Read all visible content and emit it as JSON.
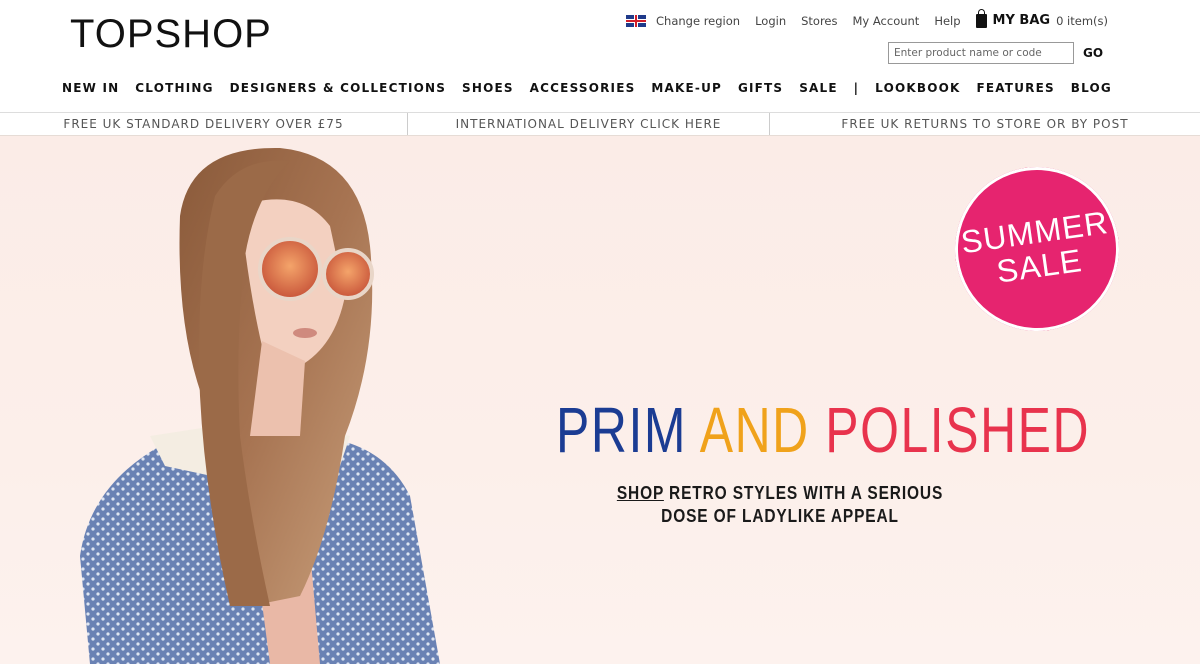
{
  "header": {
    "logo": "TOPSHOP",
    "utility": {
      "change_region": "Change region",
      "login": "Login",
      "stores": "Stores",
      "my_account": "My Account",
      "help": "Help",
      "bag_label": "MY BAG",
      "bag_count": "0 item(s)"
    },
    "search": {
      "placeholder": "Enter product name or code",
      "go_label": "GO"
    }
  },
  "nav": {
    "items": [
      "NEW IN",
      "CLOTHING",
      "DESIGNERS & COLLECTIONS",
      "SHOES",
      "ACCESSORIES",
      "MAKE-UP",
      "GIFTS",
      "SALE",
      "|",
      "LOOKBOOK",
      "FEATURES",
      "BLOG"
    ]
  },
  "promo": {
    "items": [
      "FREE UK STANDARD DELIVERY OVER £75",
      "INTERNATIONAL DELIVERY CLICK HERE",
      "FREE UK RETURNS TO STORE OR BY POST"
    ]
  },
  "hero": {
    "badge_line1": "SUMMER",
    "badge_line2": "SALE",
    "headline_word1": "PRIM",
    "headline_word2": "AND",
    "headline_word3": "POLISHED",
    "subline_link": "SHOP",
    "subline_rest1": "RETRO STYLES WITH A SERIOUS",
    "subline_line2": "DOSE OF LADYLIKE APPEAL"
  },
  "colors": {
    "badge": "#e6246f",
    "headline_blue": "#1b3c93",
    "headline_yellow": "#f0a21b",
    "headline_red": "#e8334d",
    "hero_bg": "#fbece7"
  },
  "icons": [
    "uk-flag-icon",
    "shopping-bag-icon"
  ]
}
